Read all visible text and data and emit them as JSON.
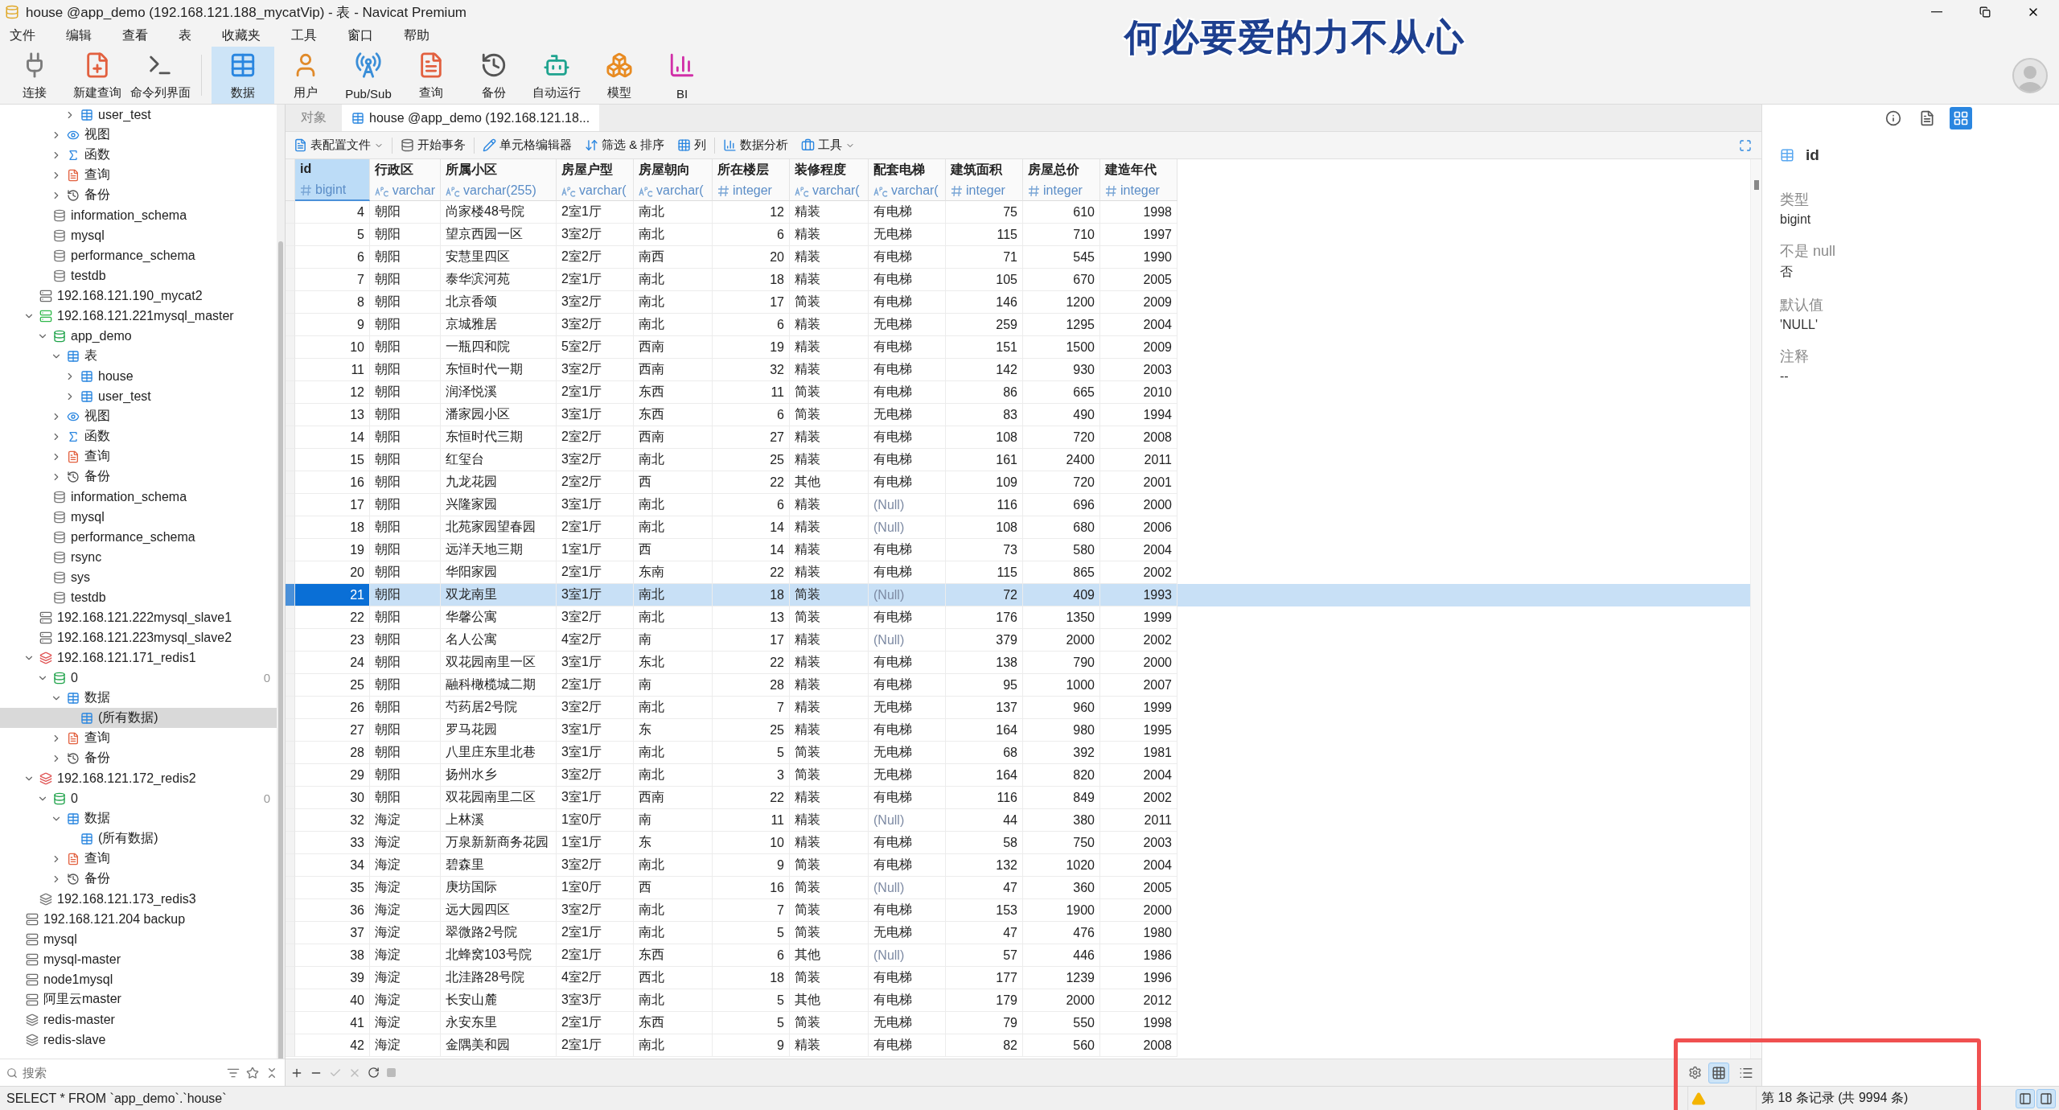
{
  "window": {
    "title": "house @app_demo (192.168.121.188_mycatVip) - 表 - Navicat Premium"
  },
  "overlay_lyric": "何必要爱的力不从心",
  "menu": [
    "文件",
    "编辑",
    "查看",
    "表",
    "收藏夹",
    "工具",
    "窗口",
    "帮助"
  ],
  "toolbar": {
    "groups": [
      [
        {
          "label": "连接",
          "kind": "connect",
          "selected": false
        },
        {
          "label": "新建查询",
          "kind": "new-query",
          "selected": false
        },
        {
          "label": "命令列界面",
          "kind": "console",
          "selected": false
        }
      ],
      [
        {
          "label": "数据",
          "kind": "data",
          "selected": true
        },
        {
          "label": "用户",
          "kind": "user",
          "selected": false
        },
        {
          "label": "Pub/Sub",
          "kind": "pubsub",
          "selected": false
        },
        {
          "label": "查询",
          "kind": "query",
          "selected": false
        },
        {
          "label": "备份",
          "kind": "backup",
          "selected": false
        },
        {
          "label": "自动运行",
          "kind": "automation",
          "selected": false
        },
        {
          "label": "模型",
          "kind": "model",
          "selected": false
        },
        {
          "label": "BI",
          "kind": "bi",
          "selected": false
        }
      ]
    ]
  },
  "sidebar": {
    "tree": [
      {
        "children": [
          {
            "children": [
              {
                "children": [
                  {
                    "children": [
                      {
                        "label": "user_test",
                        "kind": "table",
                        "expanded": false,
                        "selected": false
                      }
                    ]
                  },
                  {
                    "label": "视图",
                    "kind": "views",
                    "expanded": false,
                    "selected": false
                  },
                  {
                    "label": "函数",
                    "kind": "functions",
                    "expanded": false,
                    "selected": false
                  },
                  {
                    "label": "查询",
                    "kind": "queries",
                    "expanded": false,
                    "selected": false
                  },
                  {
                    "label": "备份",
                    "kind": "backups",
                    "expanded": false,
                    "selected": false
                  }
                ]
              },
              {
                "label": "information_schema",
                "kind": "database",
                "selected": false
              },
              {
                "label": "mysql",
                "kind": "database",
                "selected": false
              },
              {
                "label": "performance_schema",
                "kind": "database",
                "selected": false
              },
              {
                "label": "testdb",
                "kind": "database",
                "selected": false
              }
            ]
          },
          {
            "label": "192.168.121.190_mycat2",
            "kind": "mysql",
            "selected": false
          },
          {
            "label": "192.168.121.221mysql_master",
            "kind": "mysql-open",
            "expanded": true,
            "selected": false,
            "children": [
              {
                "label": "app_demo",
                "kind": "database-open",
                "expanded": true,
                "selected": false,
                "children": [
                  {
                    "label": "表",
                    "kind": "tables",
                    "expanded": true,
                    "selected": false,
                    "children": [
                      {
                        "label": "house",
                        "kind": "table",
                        "expanded": false,
                        "selected": false
                      },
                      {
                        "label": "user_test",
                        "kind": "table",
                        "expanded": false,
                        "selected": false
                      }
                    ]
                  },
                  {
                    "label": "视图",
                    "kind": "views",
                    "expanded": false,
                    "selected": false
                  },
                  {
                    "label": "函数",
                    "kind": "functions",
                    "expanded": false,
                    "selected": false
                  },
                  {
                    "label": "查询",
                    "kind": "queries",
                    "expanded": false,
                    "selected": false
                  },
                  {
                    "label": "备份",
                    "kind": "backups",
                    "expanded": false,
                    "selected": false
                  }
                ]
              },
              {
                "label": "information_schema",
                "kind": "database",
                "selected": false
              },
              {
                "label": "mysql",
                "kind": "database",
                "selected": false
              },
              {
                "label": "performance_schema",
                "kind": "database",
                "selected": false
              },
              {
                "label": "rsync",
                "kind": "database",
                "selected": false
              },
              {
                "label": "sys",
                "kind": "database",
                "selected": false
              },
              {
                "label": "testdb",
                "kind": "database",
                "selected": false
              }
            ]
          },
          {
            "label": "192.168.121.222mysql_slave1",
            "kind": "mysql",
            "selected": false
          },
          {
            "label": "192.168.121.223mysql_slave2",
            "kind": "mysql",
            "selected": false
          },
          {
            "label": "192.168.121.171_redis1",
            "kind": "redis-open",
            "expanded": true,
            "selected": false,
            "children": [
              {
                "label": "0",
                "kind": "redis-db",
                "count": "0",
                "expanded": true,
                "selected": false,
                "children": [
                  {
                    "label": "数据",
                    "kind": "tables",
                    "expanded": true,
                    "selected": false,
                    "children": [
                      {
                        "label": "(所有数据)",
                        "kind": "table",
                        "selected": true
                      }
                    ]
                  },
                  {
                    "label": "查询",
                    "kind": "queries",
                    "expanded": false,
                    "selected": false
                  },
                  {
                    "label": "备份",
                    "kind": "backups",
                    "expanded": false,
                    "selected": false
                  }
                ]
              }
            ]
          },
          {
            "label": "192.168.121.172_redis2",
            "kind": "redis-open",
            "expanded": true,
            "selected": false,
            "children": [
              {
                "label": "0",
                "kind": "redis-db",
                "count": "0",
                "expanded": true,
                "selected": false,
                "children": [
                  {
                    "label": "数据",
                    "kind": "tables",
                    "expanded": true,
                    "selected": false,
                    "children": [
                      {
                        "label": "(所有数据)",
                        "kind": "table",
                        "selected": false
                      }
                    ]
                  },
                  {
                    "label": "查询",
                    "kind": "queries",
                    "expanded": false,
                    "selected": false
                  },
                  {
                    "label": "备份",
                    "kind": "backups",
                    "expanded": false,
                    "selected": false
                  }
                ]
              }
            ]
          },
          {
            "label": "192.168.121.173_redis3",
            "kind": "redis",
            "selected": false
          }
        ]
      },
      {
        "label": "192.168.121.204 backup",
        "kind": "mysql",
        "selected": false
      },
      {
        "label": "mysql",
        "kind": "mysql",
        "selected": false
      },
      {
        "label": "mysql-master",
        "kind": "mysql",
        "selected": false
      },
      {
        "label": "node1mysql",
        "kind": "mysql",
        "selected": false
      },
      {
        "label": "阿里云master",
        "kind": "mysql",
        "selected": false
      },
      {
        "label": "redis-master",
        "kind": "redis",
        "selected": false
      },
      {
        "label": "redis-slave",
        "kind": "redis",
        "selected": false
      }
    ],
    "search": {
      "placeholder": "搜索"
    }
  },
  "tabs": [
    {
      "label": "对象",
      "selected": false
    },
    {
      "label": "house @app_demo (192.168.121.18...",
      "selected": true
    }
  ],
  "table_toolbar": [
    {
      "label": "表配置文件",
      "kind": "profile",
      "dropdown": true
    },
    {
      "label": "开始事务",
      "kind": "transaction",
      "dropdown": false
    },
    {
      "label": "单元格编辑器",
      "kind": "editor",
      "dropdown": false
    },
    {
      "label": "筛选 & 排序",
      "kind": "filter",
      "dropdown": false
    },
    {
      "label": "列",
      "kind": "columns",
      "dropdown": false
    },
    {
      "label": "数据分析",
      "kind": "analysis",
      "dropdown": false
    },
    {
      "label": "工具",
      "kind": "tools",
      "dropdown": true
    }
  ],
  "table": {
    "columns": [
      {
        "name": "id",
        "type": "bigint",
        "kind": "number",
        "selected": true
      },
      {
        "name": "行政区",
        "type": "varchar",
        "kind": "text",
        "selected": false
      },
      {
        "name": "所属小区",
        "type": "varchar(255)",
        "kind": "text",
        "selected": false
      },
      {
        "name": "房屋户型",
        "type": "varchar(",
        "kind": "text",
        "selected": false
      },
      {
        "name": "房屋朝向",
        "type": "varchar(",
        "kind": "text",
        "selected": false
      },
      {
        "name": "所在楼层",
        "type": "integer",
        "kind": "number",
        "selected": false
      },
      {
        "name": "装修程度",
        "type": "varchar(",
        "kind": "text",
        "selected": false
      },
      {
        "name": "配套电梯",
        "type": "varchar(",
        "kind": "text",
        "selected": false
      },
      {
        "name": "建筑面积",
        "type": "integer",
        "kind": "number",
        "selected": false
      },
      {
        "name": "房屋总价",
        "type": "integer",
        "kind": "number",
        "selected": false
      },
      {
        "name": "建造年代",
        "type": "integer",
        "kind": "number",
        "selected": false
      }
    ],
    "rows": [
      {
        "selected": false,
        "cells": [
          "4",
          "朝阳",
          "尚家楼48号院",
          "2室1厅",
          "南北",
          "12",
          "精装",
          "有电梯",
          "75",
          "610",
          "1998"
        ]
      },
      {
        "selected": false,
        "cells": [
          "5",
          "朝阳",
          "望京西园一区",
          "3室2厅",
          "南北",
          "6",
          "精装",
          "无电梯",
          "115",
          "710",
          "1997"
        ]
      },
      {
        "selected": false,
        "cells": [
          "6",
          "朝阳",
          "安慧里四区",
          "2室2厅",
          "南西",
          "20",
          "精装",
          "有电梯",
          "71",
          "545",
          "1990"
        ]
      },
      {
        "selected": false,
        "cells": [
          "7",
          "朝阳",
          "泰华滨河苑",
          "2室1厅",
          "南北",
          "18",
          "精装",
          "有电梯",
          "105",
          "670",
          "2005"
        ]
      },
      {
        "selected": false,
        "cells": [
          "8",
          "朝阳",
          "北京香颂",
          "3室2厅",
          "南北",
          "17",
          "简装",
          "有电梯",
          "146",
          "1200",
          "2009"
        ]
      },
      {
        "selected": false,
        "cells": [
          "9",
          "朝阳",
          "京城雅居",
          "3室2厅",
          "南北",
          "6",
          "精装",
          "无电梯",
          "259",
          "1295",
          "2004"
        ]
      },
      {
        "selected": false,
        "cells": [
          "10",
          "朝阳",
          "一瓶四和院",
          "5室2厅",
          "西南",
          "19",
          "精装",
          "有电梯",
          "151",
          "1500",
          "2009"
        ]
      },
      {
        "selected": false,
        "cells": [
          "11",
          "朝阳",
          "东恒时代一期",
          "3室2厅",
          "西南",
          "32",
          "精装",
          "有电梯",
          "142",
          "930",
          "2003"
        ]
      },
      {
        "selected": false,
        "cells": [
          "12",
          "朝阳",
          "润泽悦溪",
          "2室1厅",
          "东西",
          "11",
          "简装",
          "有电梯",
          "86",
          "665",
          "2010"
        ]
      },
      {
        "selected": false,
        "cells": [
          "13",
          "朝阳",
          "潘家园小区",
          "3室1厅",
          "东西",
          "6",
          "简装",
          "无电梯",
          "83",
          "490",
          "1994"
        ]
      },
      {
        "selected": false,
        "cells": [
          "14",
          "朝阳",
          "东恒时代三期",
          "2室2厅",
          "西南",
          "27",
          "精装",
          "有电梯",
          "108",
          "720",
          "2008"
        ]
      },
      {
        "selected": false,
        "cells": [
          "15",
          "朝阳",
          "红玺台",
          "3室2厅",
          "南北",
          "25",
          "精装",
          "有电梯",
          "161",
          "2400",
          "2011"
        ]
      },
      {
        "selected": false,
        "cells": [
          "16",
          "朝阳",
          "九龙花园",
          "2室2厅",
          "西",
          "22",
          "其他",
          "有电梯",
          "109",
          "720",
          "2001"
        ]
      },
      {
        "selected": false,
        "cells": [
          "17",
          "朝阳",
          "兴隆家园",
          "3室1厅",
          "南北",
          "6",
          "精装",
          {
            "text": "(Null)",
            "null": true
          },
          "116",
          "696",
          "2000"
        ]
      },
      {
        "selected": false,
        "cells": [
          "18",
          "朝阳",
          "北苑家园望春园",
          "2室1厅",
          "南北",
          "14",
          "精装",
          {
            "text": "(Null)",
            "null": true
          },
          "108",
          "680",
          "2006"
        ]
      },
      {
        "selected": false,
        "cells": [
          "19",
          "朝阳",
          "远洋天地三期",
          "1室1厅",
          "西",
          "14",
          "精装",
          "有电梯",
          "73",
          "580",
          "2004"
        ]
      },
      {
        "selected": false,
        "cells": [
          "20",
          "朝阳",
          "华阳家园",
          "2室1厅",
          "东南",
          "22",
          "精装",
          "有电梯",
          "115",
          "865",
          "2002"
        ]
      },
      {
        "selected": true,
        "cells": [
          "21",
          "朝阳",
          "双龙南里",
          "3室1厅",
          "南北",
          "18",
          "简装",
          {
            "text": "(Null)",
            "null": true
          },
          "72",
          "409",
          "1993"
        ]
      },
      {
        "selected": false,
        "cells": [
          "22",
          "朝阳",
          "华馨公寓",
          "3室2厅",
          "南北",
          "13",
          "简装",
          "有电梯",
          "176",
          "1350",
          "1999"
        ]
      },
      {
        "selected": false,
        "cells": [
          "23",
          "朝阳",
          "名人公寓",
          "4室2厅",
          "南",
          "17",
          "精装",
          {
            "text": "(Null)",
            "null": true
          },
          "379",
          "2000",
          "2002"
        ]
      },
      {
        "selected": false,
        "cells": [
          "24",
          "朝阳",
          "双花园南里一区",
          "3室1厅",
          "东北",
          "22",
          "精装",
          "有电梯",
          "138",
          "790",
          "2000"
        ]
      },
      {
        "selected": false,
        "cells": [
          "25",
          "朝阳",
          "融科橄榄城二期",
          "2室1厅",
          "南",
          "28",
          "精装",
          "有电梯",
          "95",
          "1000",
          "2007"
        ]
      },
      {
        "selected": false,
        "cells": [
          "26",
          "朝阳",
          "芍药居2号院",
          "3室2厅",
          "南北",
          "7",
          "精装",
          "无电梯",
          "137",
          "960",
          "1999"
        ]
      },
      {
        "selected": false,
        "cells": [
          "27",
          "朝阳",
          "罗马花园",
          "3室1厅",
          "东",
          "25",
          "精装",
          "有电梯",
          "164",
          "980",
          "1995"
        ]
      },
      {
        "selected": false,
        "cells": [
          "28",
          "朝阳",
          "八里庄东里北巷",
          "3室1厅",
          "南北",
          "5",
          "简装",
          "无电梯",
          "68",
          "392",
          "1981"
        ]
      },
      {
        "selected": false,
        "cells": [
          "29",
          "朝阳",
          "扬州水乡",
          "3室2厅",
          "南北",
          "3",
          "简装",
          "无电梯",
          "164",
          "820",
          "2004"
        ]
      },
      {
        "selected": false,
        "cells": [
          "30",
          "朝阳",
          "双花园南里二区",
          "3室1厅",
          "西南",
          "22",
          "精装",
          "有电梯",
          "116",
          "849",
          "2002"
        ]
      },
      {
        "selected": false,
        "cells": [
          "32",
          "海淀",
          "上林溪",
          "1室0厅",
          "南",
          "11",
          "精装",
          {
            "text": "(Null)",
            "null": true
          },
          "44",
          "380",
          "2011"
        ]
      },
      {
        "selected": false,
        "cells": [
          "33",
          "海淀",
          "万泉新新商务花园",
          "1室1厅",
          "东",
          "10",
          "精装",
          "有电梯",
          "58",
          "750",
          "2003"
        ]
      },
      {
        "selected": false,
        "cells": [
          "34",
          "海淀",
          "碧森里",
          "3室2厅",
          "南北",
          "9",
          "简装",
          "有电梯",
          "132",
          "1020",
          "2004"
        ]
      },
      {
        "selected": false,
        "cells": [
          "35",
          "海淀",
          "庚坊国际",
          "1室0厅",
          "西",
          "16",
          "简装",
          {
            "text": "(Null)",
            "null": true
          },
          "47",
          "360",
          "2005"
        ]
      },
      {
        "selected": false,
        "cells": [
          "36",
          "海淀",
          "远大园四区",
          "3室2厅",
          "南北",
          "7",
          "简装",
          "有电梯",
          "153",
          "1900",
          "2000"
        ]
      },
      {
        "selected": false,
        "cells": [
          "37",
          "海淀",
          "翠微路2号院",
          "2室1厅",
          "南北",
          "5",
          "简装",
          "无电梯",
          "47",
          "476",
          "1980"
        ]
      },
      {
        "selected": false,
        "cells": [
          "38",
          "海淀",
          "北蜂窝103号院",
          "2室1厅",
          "东西",
          "6",
          "其他",
          {
            "text": "(Null)",
            "null": true
          },
          "57",
          "446",
          "1986"
        ]
      },
      {
        "selected": false,
        "cells": [
          "39",
          "海淀",
          "北洼路28号院",
          "4室2厅",
          "西北",
          "18",
          "简装",
          "有电梯",
          "177",
          "1239",
          "1996"
        ]
      },
      {
        "selected": false,
        "cells": [
          "40",
          "海淀",
          "长安山麓",
          "3室3厅",
          "南北",
          "5",
          "其他",
          "有电梯",
          "179",
          "2000",
          "2012"
        ]
      },
      {
        "selected": false,
        "cells": [
          "41",
          "海淀",
          "永安东里",
          "2室1厅",
          "东西",
          "5",
          "简装",
          "无电梯",
          "79",
          "550",
          "1998"
        ]
      },
      {
        "selected": false,
        "cells": [
          "42",
          "海淀",
          "金隅美和园",
          "2室1厅",
          "南北",
          "9",
          "精装",
          "有电梯",
          "82",
          "560",
          "2008"
        ]
      }
    ]
  },
  "view_modes": [
    {
      "kind": "grid",
      "selected": true
    },
    {
      "kind": "form",
      "selected": false
    }
  ],
  "field_panel": {
    "tabs": [
      {
        "kind": "info",
        "selected": false
      },
      {
        "kind": "ddl",
        "selected": false
      },
      {
        "kind": "fields",
        "selected": true
      }
    ],
    "field": "id",
    "properties": [
      {
        "label": "类型",
        "value": "bigint"
      },
      {
        "label": "不是 null",
        "value": "否"
      },
      {
        "label": "默认值",
        "value": "'NULL'"
      },
      {
        "label": "注释",
        "value": "--"
      }
    ]
  },
  "status_bar": {
    "sql": "SELECT * FROM `app_demo`.`house`",
    "record": "第 18 条记录 (共 9994 条)",
    "panels": [
      {
        "kind": "left",
        "on": true
      },
      {
        "kind": "right",
        "on": true
      }
    ]
  },
  "annotation": {
    "color": "#f05050"
  }
}
